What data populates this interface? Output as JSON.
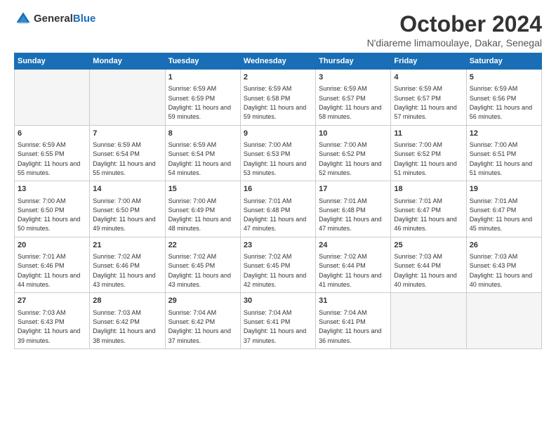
{
  "header": {
    "logo": {
      "general": "General",
      "blue": "Blue"
    },
    "title": "October 2024",
    "location": "N'diareme limamoulaye, Dakar, Senegal"
  },
  "weekdays": [
    "Sunday",
    "Monday",
    "Tuesday",
    "Wednesday",
    "Thursday",
    "Friday",
    "Saturday"
  ],
  "weeks": [
    [
      {
        "day": "",
        "empty": true
      },
      {
        "day": "",
        "empty": true
      },
      {
        "day": "1",
        "sunrise": "6:59 AM",
        "sunset": "6:59 PM",
        "daylight": "11 hours and 59 minutes."
      },
      {
        "day": "2",
        "sunrise": "6:59 AM",
        "sunset": "6:58 PM",
        "daylight": "11 hours and 59 minutes."
      },
      {
        "day": "3",
        "sunrise": "6:59 AM",
        "sunset": "6:57 PM",
        "daylight": "11 hours and 58 minutes."
      },
      {
        "day": "4",
        "sunrise": "6:59 AM",
        "sunset": "6:57 PM",
        "daylight": "11 hours and 57 minutes."
      },
      {
        "day": "5",
        "sunrise": "6:59 AM",
        "sunset": "6:56 PM",
        "daylight": "11 hours and 56 minutes."
      }
    ],
    [
      {
        "day": "6",
        "sunrise": "6:59 AM",
        "sunset": "6:55 PM",
        "daylight": "11 hours and 55 minutes."
      },
      {
        "day": "7",
        "sunrise": "6:59 AM",
        "sunset": "6:54 PM",
        "daylight": "11 hours and 55 minutes."
      },
      {
        "day": "8",
        "sunrise": "6:59 AM",
        "sunset": "6:54 PM",
        "daylight": "11 hours and 54 minutes."
      },
      {
        "day": "9",
        "sunrise": "7:00 AM",
        "sunset": "6:53 PM",
        "daylight": "11 hours and 53 minutes."
      },
      {
        "day": "10",
        "sunrise": "7:00 AM",
        "sunset": "6:52 PM",
        "daylight": "11 hours and 52 minutes."
      },
      {
        "day": "11",
        "sunrise": "7:00 AM",
        "sunset": "6:52 PM",
        "daylight": "11 hours and 51 minutes."
      },
      {
        "day": "12",
        "sunrise": "7:00 AM",
        "sunset": "6:51 PM",
        "daylight": "11 hours and 51 minutes."
      }
    ],
    [
      {
        "day": "13",
        "sunrise": "7:00 AM",
        "sunset": "6:50 PM",
        "daylight": "11 hours and 50 minutes."
      },
      {
        "day": "14",
        "sunrise": "7:00 AM",
        "sunset": "6:50 PM",
        "daylight": "11 hours and 49 minutes."
      },
      {
        "day": "15",
        "sunrise": "7:00 AM",
        "sunset": "6:49 PM",
        "daylight": "11 hours and 48 minutes."
      },
      {
        "day": "16",
        "sunrise": "7:01 AM",
        "sunset": "6:48 PM",
        "daylight": "11 hours and 47 minutes."
      },
      {
        "day": "17",
        "sunrise": "7:01 AM",
        "sunset": "6:48 PM",
        "daylight": "11 hours and 47 minutes."
      },
      {
        "day": "18",
        "sunrise": "7:01 AM",
        "sunset": "6:47 PM",
        "daylight": "11 hours and 46 minutes."
      },
      {
        "day": "19",
        "sunrise": "7:01 AM",
        "sunset": "6:47 PM",
        "daylight": "11 hours and 45 minutes."
      }
    ],
    [
      {
        "day": "20",
        "sunrise": "7:01 AM",
        "sunset": "6:46 PM",
        "daylight": "11 hours and 44 minutes."
      },
      {
        "day": "21",
        "sunrise": "7:02 AM",
        "sunset": "6:46 PM",
        "daylight": "11 hours and 43 minutes."
      },
      {
        "day": "22",
        "sunrise": "7:02 AM",
        "sunset": "6:45 PM",
        "daylight": "11 hours and 43 minutes."
      },
      {
        "day": "23",
        "sunrise": "7:02 AM",
        "sunset": "6:45 PM",
        "daylight": "11 hours and 42 minutes."
      },
      {
        "day": "24",
        "sunrise": "7:02 AM",
        "sunset": "6:44 PM",
        "daylight": "11 hours and 41 minutes."
      },
      {
        "day": "25",
        "sunrise": "7:03 AM",
        "sunset": "6:44 PM",
        "daylight": "11 hours and 40 minutes."
      },
      {
        "day": "26",
        "sunrise": "7:03 AM",
        "sunset": "6:43 PM",
        "daylight": "11 hours and 40 minutes."
      }
    ],
    [
      {
        "day": "27",
        "sunrise": "7:03 AM",
        "sunset": "6:43 PM",
        "daylight": "11 hours and 39 minutes."
      },
      {
        "day": "28",
        "sunrise": "7:03 AM",
        "sunset": "6:42 PM",
        "daylight": "11 hours and 38 minutes."
      },
      {
        "day": "29",
        "sunrise": "7:04 AM",
        "sunset": "6:42 PM",
        "daylight": "11 hours and 37 minutes."
      },
      {
        "day": "30",
        "sunrise": "7:04 AM",
        "sunset": "6:41 PM",
        "daylight": "11 hours and 37 minutes."
      },
      {
        "day": "31",
        "sunrise": "7:04 AM",
        "sunset": "6:41 PM",
        "daylight": "11 hours and 36 minutes."
      },
      {
        "day": "",
        "empty": true
      },
      {
        "day": "",
        "empty": true
      }
    ]
  ],
  "labels": {
    "sunrise": "Sunrise:",
    "sunset": "Sunset:",
    "daylight": "Daylight:"
  }
}
